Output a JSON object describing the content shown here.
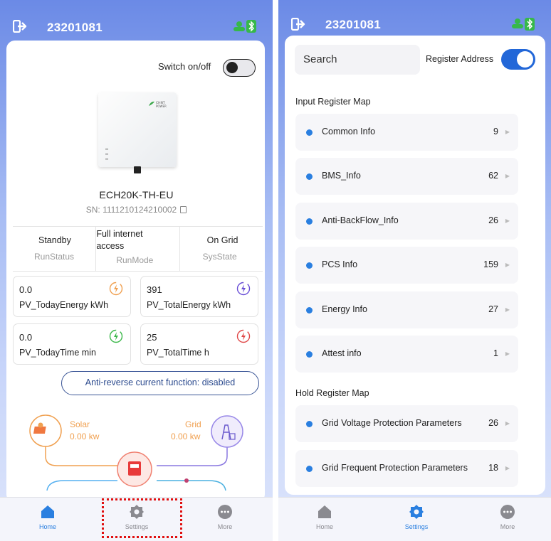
{
  "left": {
    "header": {
      "title": "23201081"
    },
    "switch_label": "Switch on/off",
    "device": {
      "model": "ECH20K-TH-EU",
      "sn": "SN: 1111210124210002",
      "logo_text": "CHNT POWER"
    },
    "status": [
      {
        "value": "Standby",
        "key": "RunStatus"
      },
      {
        "value": "Full internet access",
        "key": "RunMode"
      },
      {
        "value": "On Grid",
        "key": "SysState"
      }
    ],
    "metrics": [
      {
        "value": "0.0",
        "label": "PV_TodayEnergy kWh",
        "icon": "bolt-icon",
        "color": "#f0a050"
      },
      {
        "value": "391",
        "label": "PV_TotalEnergy kWh",
        "icon": "bolt-icon",
        "color": "#6a4fd6"
      },
      {
        "value": "0.0",
        "label": "PV_TodayTime min",
        "icon": "bolt-icon",
        "color": "#3bb84a"
      },
      {
        "value": "25",
        "label": "PV_TotalTime h",
        "icon": "bolt-icon",
        "color": "#e04848"
      }
    ],
    "anti_reverse": "Anti-reverse current function: disabled",
    "flow": {
      "solar": {
        "label": "Solar",
        "value": "0.00 kw"
      },
      "grid": {
        "label": "Grid",
        "value": "0.00 kw"
      }
    }
  },
  "right": {
    "header": {
      "title": "23201081"
    },
    "search": {
      "placeholder": "Search"
    },
    "register_address_label": "Register Address",
    "input_section": "Input Register Map",
    "input_rows": [
      {
        "label": "Common Info",
        "count": "9"
      },
      {
        "label": "BMS_Info",
        "count": "62"
      },
      {
        "label": "Anti-BackFlow_Info",
        "count": "26"
      },
      {
        "label": "PCS Info",
        "count": "159"
      },
      {
        "label": "Energy Info",
        "count": "27"
      },
      {
        "label": "Attest info",
        "count": "1"
      }
    ],
    "hold_section": "Hold Register Map",
    "hold_rows": [
      {
        "label": "Grid Voltage Protection Parameters",
        "count": "26"
      },
      {
        "label": "Grid Frequent Protection Parameters",
        "count": "18"
      }
    ]
  },
  "nav": {
    "home": "Home",
    "settings": "Settings",
    "more": "More",
    "active_color": "#2a7fe0",
    "inactive_color": "#8a8a90"
  }
}
